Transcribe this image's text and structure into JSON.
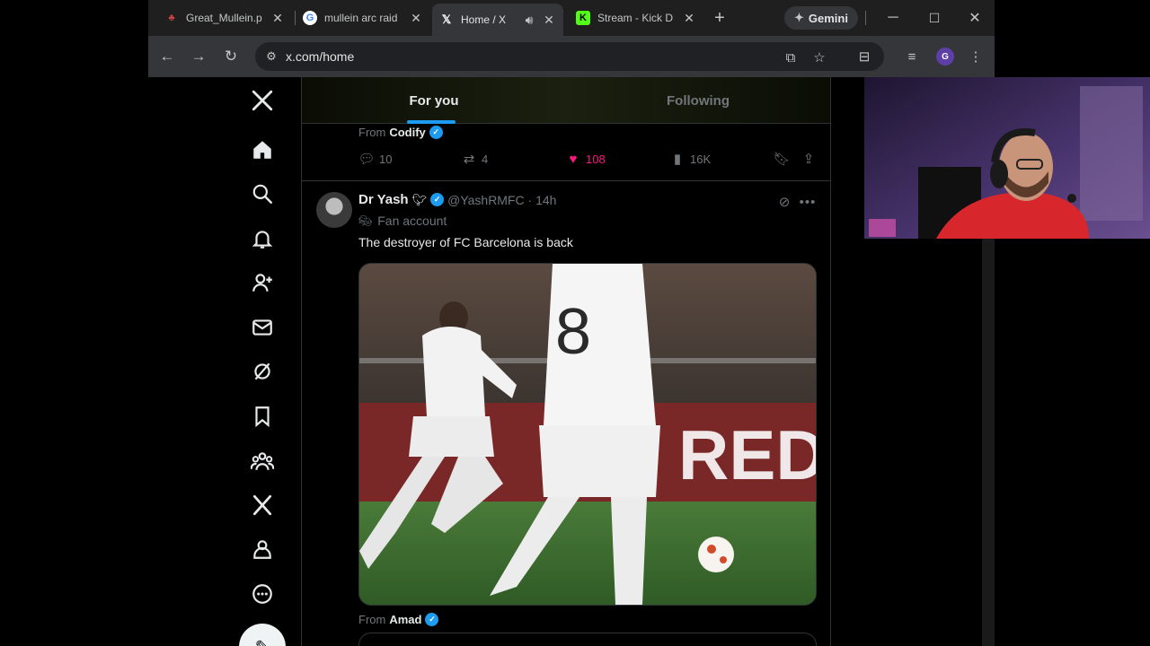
{
  "browser": {
    "tabs": [
      {
        "title": "Great_Mullein.p",
        "favicon": "image-icon",
        "active": false
      },
      {
        "title": "mullein arc raid",
        "favicon": "google-icon",
        "active": false
      },
      {
        "title": "Home / X",
        "favicon": "x-icon",
        "active": true,
        "audio": true
      },
      {
        "title": "Stream - Kick D",
        "favicon": "kick-icon",
        "active": false
      }
    ],
    "gemini_label": "Gemini",
    "url": "x.com/home",
    "profile_initial": "G"
  },
  "timeline": {
    "tabs": [
      {
        "label": "For you",
        "active": true
      },
      {
        "label": "Following",
        "active": false
      }
    ],
    "prev_tweet": {
      "from_prefix": "From",
      "from_name": "Codify",
      "replies": "10",
      "reposts": "4",
      "likes": "108",
      "views": "16K"
    },
    "tweet": {
      "name": "Dr Yash",
      "handle_time": "@YashRMFC · 14h",
      "label": "Fan account",
      "text": "The destroyer of FC Barcelona is back",
      "media_jersey_number": "8",
      "media_ad_text": "RED",
      "from_prefix": "From",
      "from_name": "Amad"
    }
  },
  "colors": {
    "accent": "#1d9bf0",
    "like": "#f91880",
    "background": "#000000"
  }
}
